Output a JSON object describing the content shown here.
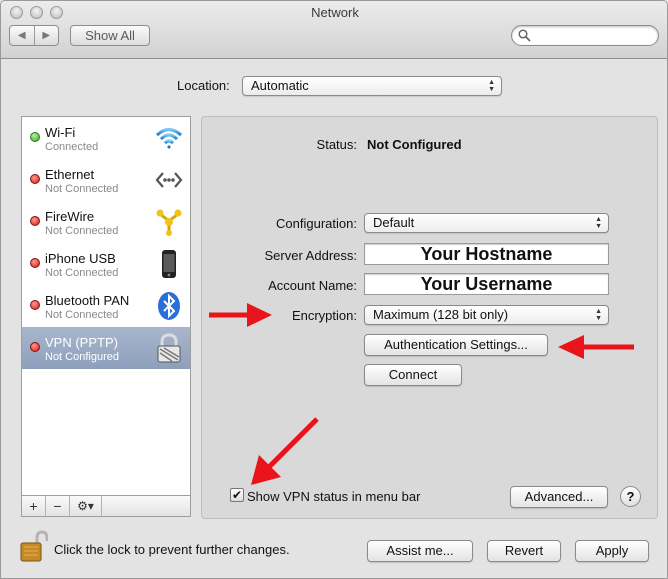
{
  "window": {
    "title": "Network"
  },
  "toolbar": {
    "back_glyph": "◀",
    "forward_glyph": "▶",
    "show_all_label": "Show All",
    "search_placeholder": ""
  },
  "location": {
    "label": "Location:",
    "value": "Automatic"
  },
  "services": [
    {
      "name": "Wi-Fi",
      "status": "Connected",
      "state": "green",
      "icon": "wifi-icon"
    },
    {
      "name": "Ethernet",
      "status": "Not Connected",
      "state": "red",
      "icon": "ethernet-icon"
    },
    {
      "name": "FireWire",
      "status": "Not Connected",
      "state": "red",
      "icon": "firewire-icon"
    },
    {
      "name": "iPhone USB",
      "status": "Not Connected",
      "state": "red",
      "icon": "iphone-icon"
    },
    {
      "name": "Bluetooth PAN",
      "status": "Not Connected",
      "state": "red",
      "icon": "bluetooth-icon"
    },
    {
      "name": "VPN (PPTP)",
      "status": "Not Configured",
      "state": "red",
      "icon": "lock-icon",
      "selected": true
    }
  ],
  "sidebar_tools": {
    "add": "+",
    "remove": "−",
    "gear": "⚙▾"
  },
  "detail": {
    "status_label": "Status:",
    "status_value": "Not Configured",
    "configuration_label": "Configuration:",
    "configuration_value": "Default",
    "server_label": "Server Address:",
    "server_value": "Your Hostname",
    "account_label": "Account Name:",
    "account_value": "Your Username",
    "encryption_label": "Encryption:",
    "encryption_value": "Maximum (128 bit only)",
    "auth_button": "Authentication Settings...",
    "connect_button": "Connect",
    "show_status_label": "Show VPN status in menu bar",
    "show_status_checked": "✔",
    "advanced_button": "Advanced...",
    "help_glyph": "?"
  },
  "footer": {
    "lock_text": "Click the lock to prevent further changes.",
    "assist_button": "Assist me...",
    "revert_button": "Revert",
    "apply_button": "Apply"
  },
  "colors": {
    "annotation_arrow": "#e8141a",
    "selection": "#97a8c4"
  }
}
